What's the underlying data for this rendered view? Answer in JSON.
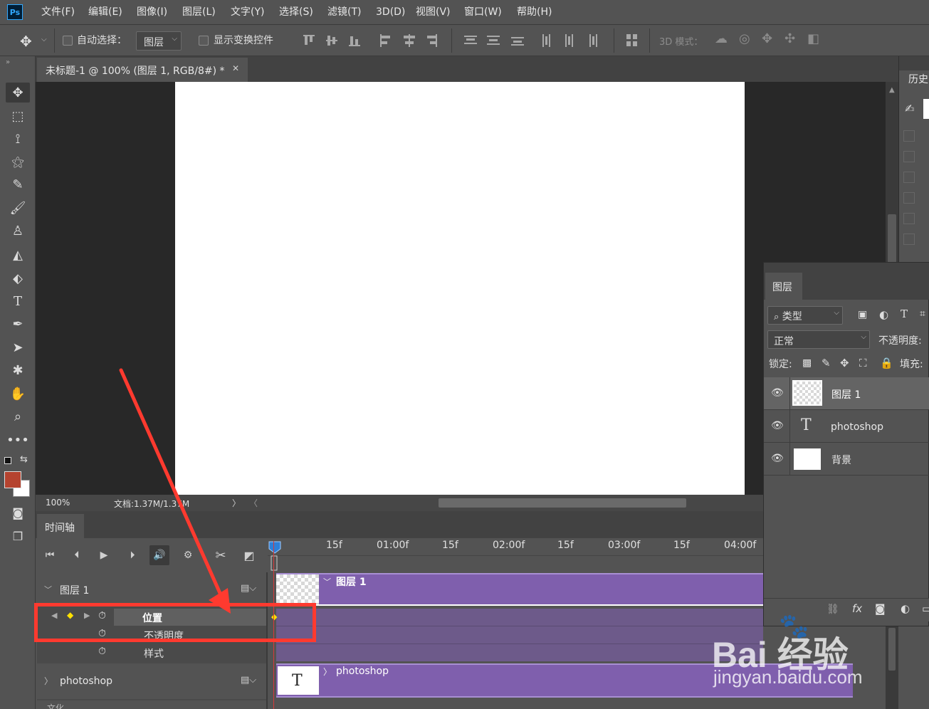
{
  "app": {
    "logo": "Ps",
    "accent": "#31a8ff"
  },
  "menu": [
    "文件(F)",
    "编辑(E)",
    "图像(I)",
    "图层(L)",
    "文字(Y)",
    "选择(S)",
    "滤镜(T)",
    "3D(D)",
    "视图(V)",
    "窗口(W)",
    "帮助(H)"
  ],
  "options": {
    "auto_select_label": "自动选择：",
    "auto_select_value": "图层",
    "show_transform_label": "显示变换控件",
    "mode_3d_label": "3D 模式："
  },
  "document": {
    "tab_title": "未标题-1 @ 100% (图层 1, RGB/8#) *",
    "close": "✕",
    "zoom": "100%",
    "doc_size": "文档:1.37M/1.37M"
  },
  "timeline": {
    "tab_label": "时间轴",
    "ruler": [
      "15f",
      "01:00f",
      "15f",
      "02:00f",
      "15f",
      "03:00f",
      "15f",
      "04:00f"
    ],
    "layer1_name": "图层 1",
    "layer1_clip": "图层 1",
    "props": [
      "位置",
      "不透明度",
      "样式"
    ],
    "text_layer_name": "photoshop",
    "text_clip": "photoshop",
    "bottom_partial": "文化"
  },
  "history_panel": {
    "tab_label": "历史"
  },
  "layers_panel": {
    "tab_label": "图层",
    "filter_label": "类型",
    "blend_mode": "正常",
    "opacity_label": "不透明度:",
    "lock_label": "锁定:",
    "fill_label": "填充:",
    "layers": [
      {
        "name": "图层 1",
        "type": "pixel"
      },
      {
        "name": "photoshop",
        "type": "text"
      },
      {
        "name": "背景",
        "type": "background"
      }
    ]
  },
  "colors": {
    "foreground": "#b5432f",
    "background": "#ffffff",
    "clip_purple": "#7f5fad",
    "annotation_red": "#ff3a2f"
  },
  "watermark": {
    "logo": "Bai 经验",
    "url": "jingyan.baidu.com"
  }
}
